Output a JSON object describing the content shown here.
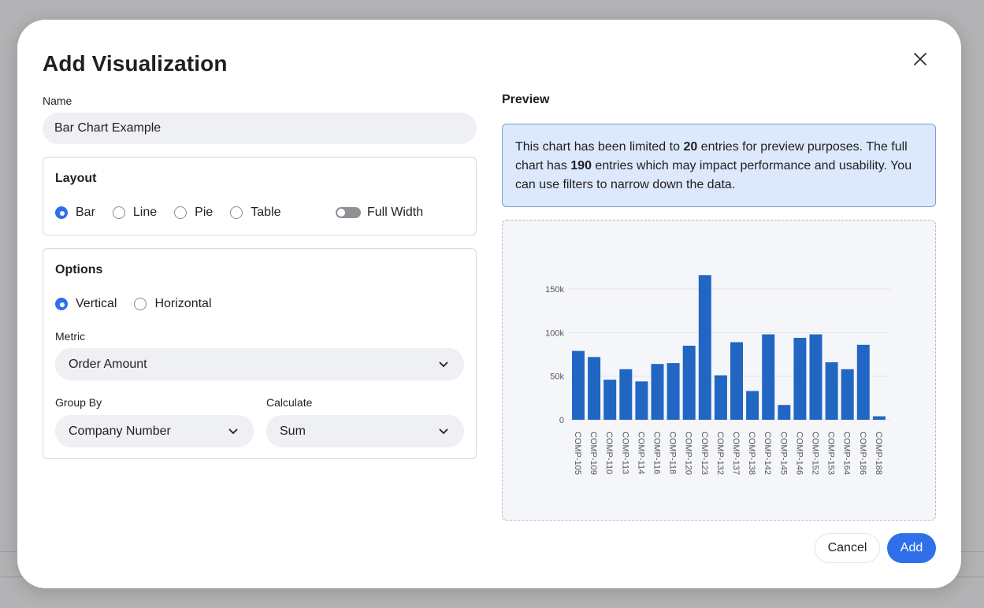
{
  "dialog": {
    "title": "Add Visualization",
    "close_icon": "close-icon"
  },
  "name_field": {
    "label": "Name",
    "value": "Bar Chart Example"
  },
  "layout": {
    "title": "Layout",
    "options": [
      {
        "label": "Bar",
        "selected": true
      },
      {
        "label": "Line",
        "selected": false
      },
      {
        "label": "Pie",
        "selected": false
      },
      {
        "label": "Table",
        "selected": false
      }
    ],
    "full_width": {
      "label": "Full Width",
      "on": false
    }
  },
  "options": {
    "title": "Options",
    "orientation": [
      {
        "label": "Vertical",
        "selected": true
      },
      {
        "label": "Horizontal",
        "selected": false
      }
    ],
    "metric": {
      "label": "Metric",
      "value": "Order Amount"
    },
    "group_by": {
      "label": "Group By",
      "value": "Company Number"
    },
    "calculate": {
      "label": "Calculate",
      "value": "Sum"
    }
  },
  "preview": {
    "label": "Preview",
    "info_part1": "This chart has been limited to ",
    "info_limit": "20",
    "info_part2": " entries for preview purposes. The full chart has ",
    "info_total": "190",
    "info_part3": " entries which may impact performance and usability. You can use filters to narrow down the data."
  },
  "buttons": {
    "cancel": "Cancel",
    "add": "Add"
  },
  "colors": {
    "accent": "#2f6fea",
    "bar": "#2266c4",
    "info_bg": "#dce8fb"
  },
  "chart_data": {
    "type": "bar",
    "orientation": "vertical",
    "categories": [
      "COMP-105",
      "COMP-109",
      "COMP-110",
      "COMP-113",
      "COMP-114",
      "COMP-116",
      "COMP-118",
      "COMP-120",
      "COMP-123",
      "COMP-132",
      "COMP-137",
      "COMP-138",
      "COMP-142",
      "COMP-145",
      "COMP-146",
      "COMP-152",
      "COMP-153",
      "COMP-164",
      "COMP-186",
      "COMP-188"
    ],
    "values": [
      79000,
      72000,
      46000,
      58000,
      44000,
      64000,
      65000,
      85000,
      166000,
      51000,
      89000,
      33000,
      98000,
      17000,
      94000,
      98000,
      66000,
      58000,
      86000,
      4000
    ],
    "ylim": [
      0,
      165000
    ],
    "yticks": [
      0,
      50000,
      100000,
      150000
    ],
    "ytick_labels": [
      "0",
      "50k",
      "100k",
      "150k"
    ],
    "grid": true
  }
}
